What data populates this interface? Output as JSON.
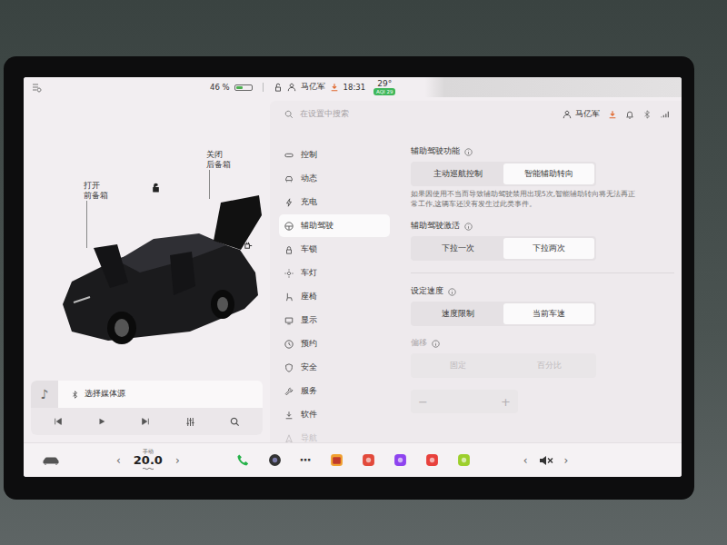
{
  "status_bar": {
    "battery": "46 %",
    "battery_level": 0.46,
    "user": "马亿军",
    "time": "18:31",
    "temperature": "29°",
    "aqi": "AQI 29"
  },
  "vehicle": {
    "locked": false,
    "doors_open": true,
    "hatches": [
      {
        "action": "打开",
        "label": "前备箱",
        "open": false
      },
      {
        "action": "关闭",
        "label": "后备箱",
        "open": true
      }
    ]
  },
  "media": {
    "icon": "♪",
    "source": "选择媒体源"
  },
  "settings": {
    "search": {
      "placeholder": "在设置中搜索"
    },
    "user": "马亿军",
    "menu": [
      {
        "label": "控制",
        "selected": false,
        "faded": false
      },
      {
        "label": "动态",
        "selected": false,
        "faded": false
      },
      {
        "label": "充电",
        "selected": false,
        "faded": false
      },
      {
        "label": "辅助驾驶",
        "selected": true,
        "faded": false
      },
      {
        "label": "车锁",
        "selected": false,
        "faded": false
      },
      {
        "label": "车灯",
        "selected": false,
        "faded": false
      },
      {
        "label": "座椅",
        "selected": false,
        "faded": false
      },
      {
        "label": "显示",
        "selected": false,
        "faded": false
      },
      {
        "label": "预约",
        "selected": false,
        "faded": false
      },
      {
        "label": "安全",
        "selected": false,
        "faded": false
      },
      {
        "label": "服务",
        "selected": false,
        "faded": false
      },
      {
        "label": "软件",
        "selected": false,
        "faded": false
      },
      {
        "label": "导航",
        "selected": false,
        "faded": true
      }
    ],
    "groups": [
      {
        "sections": [
          {
            "title": "辅助驾驶功能",
            "disabled": false,
            "options": [
              {
                "label": "主动巡航控制",
                "selected": false
              },
              {
                "label": "智能辅助转向",
                "selected": true
              }
            ],
            "note": "如果因使用不当而导致辅助驾驶禁用出现5次,智能辅助转向将无法再正常工作,这辆车还没有发生过此类事件。"
          },
          {
            "title": "辅助驾驶激活",
            "disabled": false,
            "options": [
              {
                "label": "下拉一次",
                "selected": false
              },
              {
                "label": "下拉两次",
                "selected": true
              }
            ],
            "note": ""
          }
        ],
        "stepper": null
      },
      {
        "sections": [
          {
            "title": "设定速度",
            "disabled": false,
            "options": [
              {
                "label": "速度限制",
                "selected": false
              },
              {
                "label": "当前车速",
                "selected": true
              }
            ],
            "note": ""
          },
          {
            "title": "偏移",
            "disabled": true,
            "options": [
              {
                "label": "固定",
                "selected": false
              },
              {
                "label": "百分比",
                "selected": false
              }
            ],
            "note": ""
          }
        ],
        "stepper": {
          "minus": "−",
          "plus": "+",
          "disabled": true
        }
      }
    ]
  },
  "dock": {
    "mode": "手动",
    "temperature": "20.0",
    "decrease": "‹",
    "increase": "›",
    "more": "⋯",
    "volume_down": "‹",
    "volume_up": "›",
    "muted": true
  }
}
